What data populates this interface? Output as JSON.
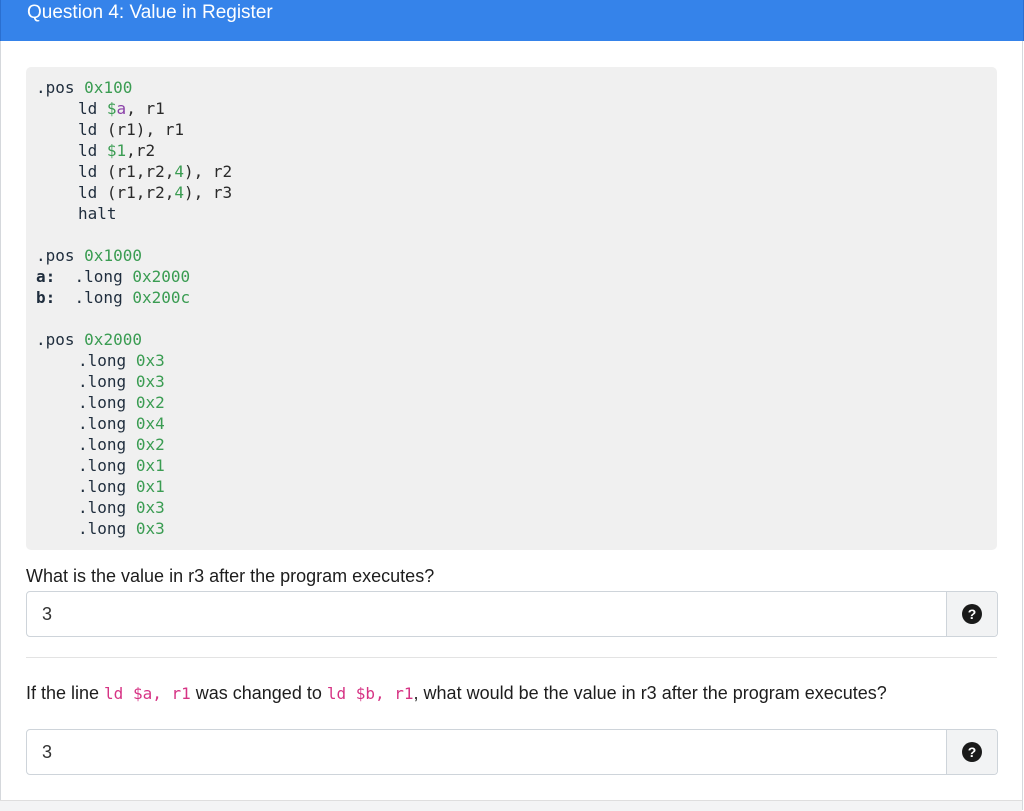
{
  "header": {
    "title": "Question 4: Value in Register"
  },
  "code": {
    "pos1": {
      "directive": ".pos",
      "address": "0x100"
    },
    "line1": {
      "op": "ld",
      "imm": "$a",
      "sep": ",",
      "reg": "r1"
    },
    "line2": {
      "op": "ld",
      "src": "(r1),",
      "reg": "r1"
    },
    "line3": {
      "op": "ld",
      "imm": "$1",
      "sep": ",",
      "reg": "r2"
    },
    "line4": {
      "op": "ld",
      "src": "(r1,r2,",
      "scale": "4",
      "close": "),",
      "reg": "r2"
    },
    "line5": {
      "op": "ld",
      "src": "(r1,r2,",
      "scale": "4",
      "close": "),",
      "reg": "r3"
    },
    "line6": {
      "op": "halt"
    },
    "pos2": {
      "directive": ".pos",
      "address": "0x1000"
    },
    "a_line": {
      "label": "a:",
      "directive": ".long",
      "value": "0x2000"
    },
    "b_line": {
      "label": "b:",
      "directive": ".long",
      "value": "0x200c"
    },
    "pos3": {
      "directive": ".pos",
      "address": "0x2000"
    },
    "longs": [
      {
        "directive": ".long",
        "value": "0x3"
      },
      {
        "directive": ".long",
        "value": "0x3"
      },
      {
        "directive": ".long",
        "value": "0x2"
      },
      {
        "directive": ".long",
        "value": "0x4"
      },
      {
        "directive": ".long",
        "value": "0x2"
      },
      {
        "directive": ".long",
        "value": "0x1"
      },
      {
        "directive": ".long",
        "value": "0x1"
      },
      {
        "directive": ".long",
        "value": "0x3"
      },
      {
        "directive": ".long",
        "value": "0x3"
      }
    ]
  },
  "question1": {
    "prompt": "What is the value in r3 after the program executes?",
    "answer": "3",
    "help_icon": "question-circle-icon"
  },
  "question2": {
    "prefix": "If the line ",
    "code1": "ld $a, r1",
    "middle": " was changed to ",
    "code2": "ld $b, r1",
    "suffix": ", what would be the value in r3 after the program executes?",
    "answer": "3",
    "help_icon": "question-circle-icon"
  },
  "colors": {
    "header_bg": "#3583ea",
    "code_bg": "#f0f0f0",
    "number": "#3a9c52",
    "variable": "#8a3fa8",
    "inline_code": "#d63384"
  }
}
